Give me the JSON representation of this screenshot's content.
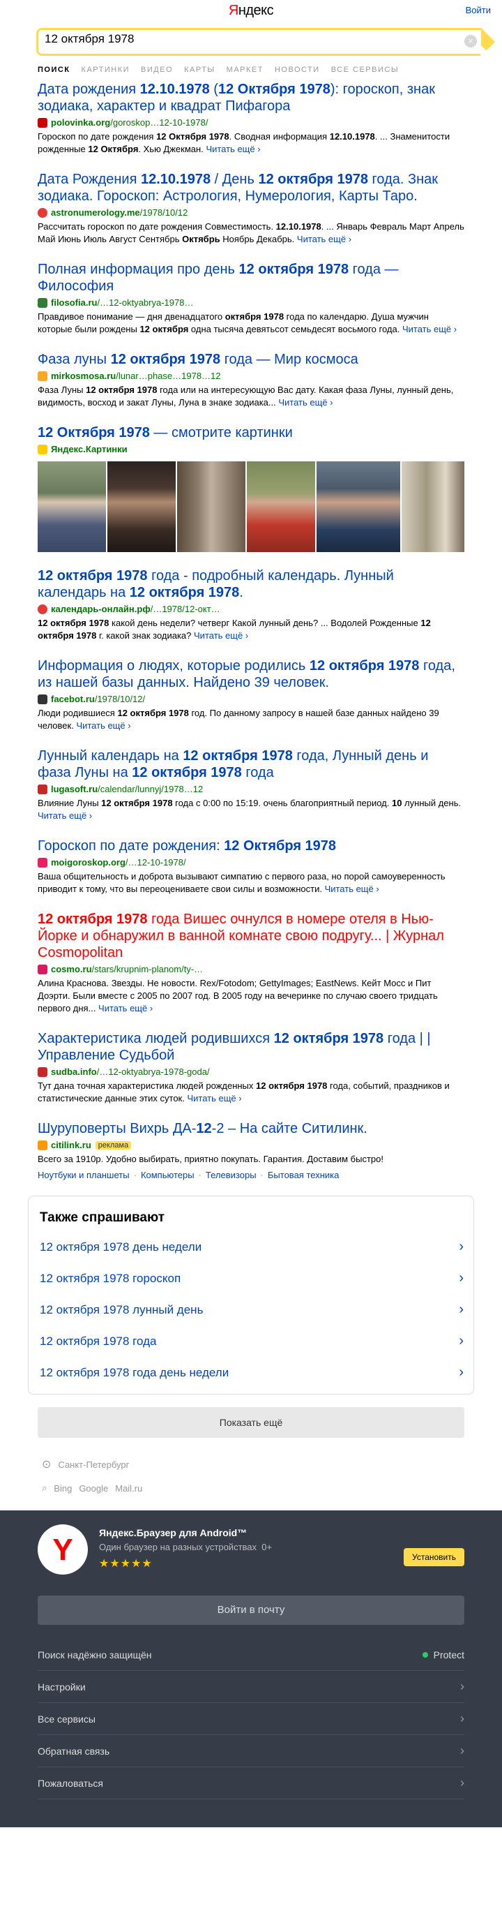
{
  "header": {
    "logo_prefix": "Я",
    "logo_rest": "ндекс",
    "login_link": "Войти"
  },
  "search": {
    "query": "12 октября 1978",
    "clear": "×"
  },
  "tabs": [
    "ПОИСК",
    "КАРТИНКИ",
    "ВИДЕО",
    "КАРТЫ",
    "МАРКЕТ",
    "НОВОСТИ",
    "ВСЕ СЕРВИСЫ"
  ],
  "results": [
    {
      "title_parts": [
        {
          "t": "Дата рождения ",
          "b": false
        },
        {
          "t": "12.10.1978",
          "b": true
        },
        {
          "t": " (",
          "b": false
        },
        {
          "t": "12 Октября 1978",
          "b": true
        },
        {
          "t": "): гороскоп, знак зодиака, характер и квадрат Пифагора",
          "b": false
        }
      ],
      "fav_color": "#c00",
      "fav_icon": "heart",
      "url_bold": "polovinka.org",
      "url_rest": "/goroskop…12-10-1978/",
      "text_parts": [
        {
          "t": "Гороскоп по дате рождения ",
          "b": false
        },
        {
          "t": "12 Октября 1978",
          "b": true
        },
        {
          "t": ". Сводная информация ",
          "b": false
        },
        {
          "t": "12.10.1978",
          "b": true
        },
        {
          "t": ". ... Знаменитости рожденные ",
          "b": false
        },
        {
          "t": "12 Октября",
          "b": true
        },
        {
          "t": ". Хью Джекман. ",
          "b": false
        }
      ],
      "more": "Читать ещё ›"
    },
    {
      "title_parts": [
        {
          "t": "Дата Рождения ",
          "b": false
        },
        {
          "t": "12.10.1978",
          "b": true
        },
        {
          "t": " / День ",
          "b": false
        },
        {
          "t": "12 октября 1978",
          "b": true
        },
        {
          "t": " года. Знак зодиака. Гороскоп: Астрология, Нумерология, Карты Таро.",
          "b": false
        }
      ],
      "fav_color": "#e53935",
      "fav_icon": "ring",
      "url_bold": "astronumerology.me",
      "url_rest": "/1978/10/12",
      "text_parts": [
        {
          "t": "Рассчитать гороскоп по дате рождения Совместимость. ",
          "b": false
        },
        {
          "t": "12.10.1978",
          "b": true
        },
        {
          "t": ". ... Январь Февраль Март Апрель Май Июнь Июль Август Сентябрь ",
          "b": false
        },
        {
          "t": "Октябрь",
          "b": true
        },
        {
          "t": " Ноябрь Декабрь. ",
          "b": false
        }
      ],
      "more": "Читать ещё ›"
    },
    {
      "title_parts": [
        {
          "t": "Полная информация про день ",
          "b": false
        },
        {
          "t": "12 октября 1978",
          "b": true
        },
        {
          "t": " года — Философия",
          "b": false
        }
      ],
      "fav_color": "#2e7d32",
      "fav_icon": "square",
      "url_bold": "filosofia.ru",
      "url_rest": "/…12-oktyabrya-1978…",
      "text_parts": [
        {
          "t": "Правдивое понимание — дня двенадцатого ",
          "b": false
        },
        {
          "t": "октября 1978",
          "b": true
        },
        {
          "t": " года по календарю. Душа мужчин которые были рождены ",
          "b": false
        },
        {
          "t": "12 октября",
          "b": true
        },
        {
          "t": " одна тысяча девятьсот семьдесят восьмого года. ",
          "b": false
        }
      ],
      "more": "Читать ещё ›"
    },
    {
      "title_parts": [
        {
          "t": "Фаза луны ",
          "b": false
        },
        {
          "t": "12 октября 1978",
          "b": true
        },
        {
          "t": " года — Мир космоса",
          "b": false
        }
      ],
      "fav_color": "#f9a825",
      "fav_icon": "drop",
      "url_bold": "mirkosmosa.ru",
      "url_rest": "/lunar…phase…1978…12",
      "text_parts": [
        {
          "t": "Фаза Луны ",
          "b": false
        },
        {
          "t": "12 октября 1978",
          "b": true
        },
        {
          "t": " года или на интересующую Вас дату. Какая фаза Луны, лунный день, видимость, восход и закат Луны, Луна в знаке зодиака... ",
          "b": false
        }
      ],
      "more": "Читать ещё ›"
    }
  ],
  "images": {
    "title_bold": "12 Октября 1978",
    "title_rest": " — смотрите картинки",
    "source": "Яндекс.Картинки"
  },
  "results2": [
    {
      "title_parts": [
        {
          "t": "12 октября 1978",
          "b": true
        },
        {
          "t": " года - подробный календарь. Лунный календарь на ",
          "b": false
        },
        {
          "t": "12 октября 1978",
          "b": true
        },
        {
          "t": ".",
          "b": false
        }
      ],
      "fav_color": "#e53935",
      "fav_icon": "circle",
      "url_bold": "календарь-онлайн.рф",
      "url_rest": "/…1978/12-окт…",
      "text_parts": [
        {
          "t": "12 октября 1978",
          "b": true
        },
        {
          "t": " какой день недели? четверг Какой лунный день? ... Водолей Рожденные ",
          "b": false
        },
        {
          "t": "12 октября 1978",
          "b": true
        },
        {
          "t": " г. какой знак зодиака? ",
          "b": false
        }
      ],
      "more": "Читать ещё ›"
    },
    {
      "title_parts": [
        {
          "t": "Информация о людях, которые родились ",
          "b": false
        },
        {
          "t": "12 октября 1978",
          "b": true
        },
        {
          "t": " года, из нашей базы данных. Найдено 39 человек.",
          "b": false
        }
      ],
      "fav_color": "#333",
      "fav_icon": "wave",
      "url_bold": "facebot.ru",
      "url_rest": "/1978/10/12/",
      "text_parts": [
        {
          "t": "Люди родившиеся ",
          "b": false
        },
        {
          "t": "12 октября 1978",
          "b": true
        },
        {
          "t": " год. По данному запросу в нашей базе данных найдено 39 человек. ",
          "b": false
        }
      ],
      "more": "Читать ещё ›"
    },
    {
      "title_parts": [
        {
          "t": "Лунный календарь на ",
          "b": false
        },
        {
          "t": "12 октября 1978",
          "b": true
        },
        {
          "t": " года, Лунный день и фаза Луны на ",
          "b": false
        },
        {
          "t": "12 октября 1978",
          "b": true
        },
        {
          "t": " года",
          "b": false
        }
      ],
      "fav_color": "#c62828",
      "fav_icon": "square",
      "url_bold": "lugasoft.ru",
      "url_rest": "/calendar/lunnyj/1978…12",
      "text_parts": [
        {
          "t": "Влияние Луны ",
          "b": false
        },
        {
          "t": "12 октября 1978",
          "b": true
        },
        {
          "t": " года с 0:00 по 15:19. очень благоприятный период. ",
          "b": false
        },
        {
          "t": "10",
          "b": true
        },
        {
          "t": " лунный день. ",
          "b": false
        }
      ],
      "more": "Читать ещё ›"
    },
    {
      "title_parts": [
        {
          "t": "Гороскоп по дате рождения: ",
          "b": false
        },
        {
          "t": "12 Октября 1978",
          "b": true
        }
      ],
      "fav_color": "#e91e63",
      "fav_icon": "square",
      "url_bold": "moigoroskop.org",
      "url_rest": "/…12-10-1978/",
      "text_parts": [
        {
          "t": "Ваша общительность и доброта вызывают симпатию с первого раза, но порой самоуверенность приводит к тому, что вы переоцениваете свои силы и возможности. ",
          "b": false
        }
      ],
      "more": "Читать ещё ›"
    },
    {
      "red": true,
      "title_parts": [
        {
          "t": "12 октября 1978",
          "b": true
        },
        {
          "t": " года Вишес очнулся в номере отеля в Нью-Йорке и обнаружил в ванной комнате свою подругу... | Журнал Cosmopolitan",
          "b": false
        }
      ],
      "fav_color": "#d81b60",
      "fav_icon": "square",
      "url_bold": "cosmo.ru",
      "url_rest": "/stars/krupnim-planom/ty-…",
      "text_parts": [
        {
          "t": "Алина Краснова. Звезды. Не новости. Rex/Fotodom; GettyImages; EastNews. Кейт Мосс и Пит Доэрти. Были вместе с 2005 по 2007 год. В 2005 году на вечеринке по случаю своего тридцать первого дня... ",
          "b": false
        }
      ],
      "more": "Читать ещё ›"
    },
    {
      "title_parts": [
        {
          "t": "Характеристика людей родившихся ",
          "b": false
        },
        {
          "t": "12 октября 1978",
          "b": true
        },
        {
          "t": " года | | Управление Судьбой",
          "b": false
        }
      ],
      "fav_color": "#c62828",
      "fav_icon": "square",
      "url_bold": "sudba.info",
      "url_rest": "/…12-oktyabrya-1978-goda/",
      "text_parts": [
        {
          "t": "Тут дана точная характеристика людей рожденных ",
          "b": false
        },
        {
          "t": "12 октября 1978",
          "b": true
        },
        {
          "t": " года, событий, праздников и статистические данные этих суток. ",
          "b": false
        }
      ],
      "more": "Читать ещё ›"
    }
  ],
  "ad": {
    "title_parts": [
      {
        "t": "Шуруповерты Вихрь ДА-",
        "b": false
      },
      {
        "t": "12",
        "b": true
      },
      {
        "t": "-2 – На сайте Ситилинк.",
        "b": false
      }
    ],
    "url_bold": "citilink.ru",
    "badge": "реклама",
    "text": "Всего за 1910р. Удобно выбирать, приятно покупать. Гарантия. Доставим быстро!",
    "sitelinks": [
      "Ноутбуки и планшеты",
      "Компьютеры",
      "Телевизоры",
      "Бытовая техника"
    ]
  },
  "also": {
    "title": "Также спрашивают",
    "items": [
      "12 октября 1978 день недели",
      "12 октября 1978 гороскоп",
      "12 октября 1978 лунный день",
      "12 октября 1978 года",
      "12 октября 1978 года день недели"
    ]
  },
  "more_button": "Показать ещё",
  "geo": "Санкт-Петербург",
  "engines": [
    "Bing",
    "Google",
    "Mail.ru"
  ],
  "footer": {
    "promo_title": "Яндекс.Браузер для Android™",
    "promo_sub": "Один браузер на разных устройствах",
    "promo_age": "0+",
    "rating_stars": "★★★★★",
    "install": "Установить",
    "login_mail": "Войти в почту",
    "items": [
      {
        "label": "Поиск надёжно защищён",
        "status": "Protect"
      },
      {
        "label": "Настройки"
      },
      {
        "label": "Все сервисы"
      },
      {
        "label": "Обратная связь"
      },
      {
        "label": "Пожаловаться"
      }
    ]
  },
  "colors": {
    "link": "#0044bb",
    "url_green": "#007700",
    "accent_yellow": "#ffdb4d",
    "footer_bg": "#373d48"
  }
}
